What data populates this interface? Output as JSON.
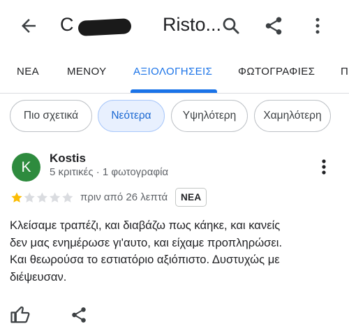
{
  "appbar": {
    "title": "C                 Risto...",
    "back_icon": "arrow-left-icon",
    "search_icon": "search-icon",
    "share_icon": "share-icon",
    "more_icon": "more-vert-icon"
  },
  "tabs": [
    {
      "label": "ΝΕΑ"
    },
    {
      "label": "ΜΕΝΟΥ"
    },
    {
      "label": "ΑΞΙΟΛΟΓΗΣΕΙΣ"
    },
    {
      "label": "ΦΩΤΟΓΡΑΦΙΕΣ"
    },
    {
      "label": "Π"
    }
  ],
  "active_tab": "ΑΞΙΟΛΟΓΗΣΕΙΣ",
  "sort_chips": [
    {
      "label": "Πιο σχετικά"
    },
    {
      "label": "Νεότερα"
    },
    {
      "label": "Υψηλότερη"
    },
    {
      "label": "Χαμηλότερη"
    }
  ],
  "selected_chip": "Νεότερα",
  "review": {
    "avatar_letter": "K",
    "author": "Kostis",
    "author_meta": "5 κριτικές · 1 φωτογραφία",
    "rating": 1,
    "rating_max": 5,
    "time": "πριν από 26 λεπτά",
    "badge": "ΝΕΑ",
    "lines": [
      "Κλείσαμε τραπέζι, και διαβάζω πως κάηκε, και κανείς",
      "δεν μας ενημέρωσε γι'αυτο, και είχαμε προπληρώσει.",
      "Και θεωρούσα το εστιατόριο αξιόπιστο. Δυστυχώς με",
      "διέψευσαν."
    ],
    "like_icon": "thumbs-up-icon",
    "share_icon": "share-icon"
  },
  "colors": {
    "accent": "#1a73e8",
    "avatar": "#2e8b3e",
    "star_filled": "#fbbc04",
    "star_empty": "#dadce0",
    "chip_selected_bg": "#e8f0fe"
  }
}
